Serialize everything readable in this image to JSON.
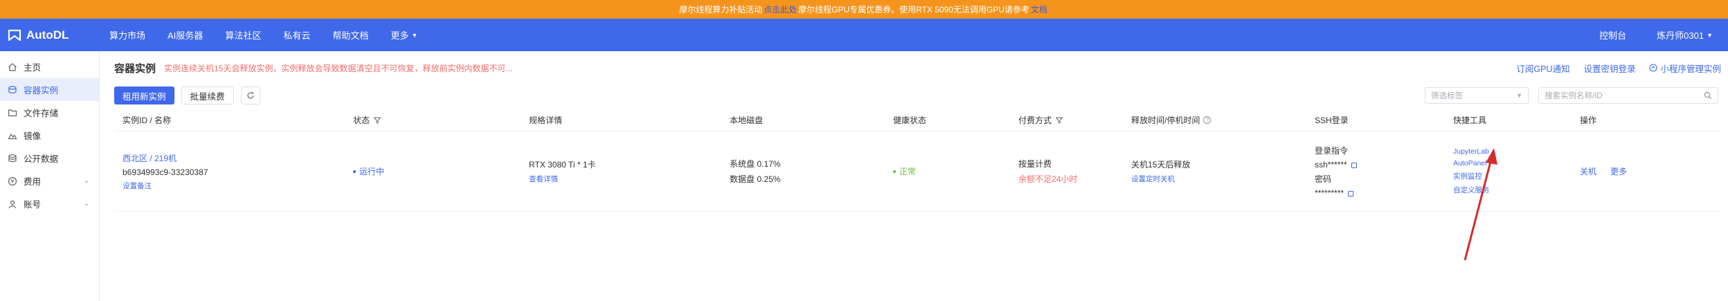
{
  "banner": {
    "text_pre": "摩尔线程算力补贴活动",
    "link1": "点击此处",
    "text_mid": "摩尔线程GPU专属优惠券。使用RTX 5090无法调用GPU请参考",
    "link2": "文档"
  },
  "nav": {
    "logo": "AutoDL",
    "items": [
      {
        "label": "算力市场"
      },
      {
        "label": "AI服务器"
      },
      {
        "label": "算法社区"
      },
      {
        "label": "私有云"
      },
      {
        "label": "帮助文档"
      },
      {
        "label": "更多"
      }
    ],
    "console": "控制台",
    "user": "炼丹师0301"
  },
  "sidebar": {
    "items": [
      {
        "label": "主页",
        "icon": "home-icon"
      },
      {
        "label": "容器实例",
        "icon": "container-icon"
      },
      {
        "label": "文件存储",
        "icon": "folder-icon"
      },
      {
        "label": "镜像",
        "icon": "image-icon"
      },
      {
        "label": "公开数据",
        "icon": "database-icon"
      },
      {
        "label": "费用",
        "icon": "yen-icon"
      },
      {
        "label": "账号",
        "icon": "user-icon"
      }
    ]
  },
  "main": {
    "title": "容器实例",
    "notice": "实例连续关机15天会释放实例，实例释放会导致数据清空且不可恢复，释放前实例内数据不可...",
    "links": {
      "gpu_notify": "订阅GPU通知",
      "key_login": "设置密钥登录",
      "mini_program": "小程序管理实例"
    },
    "toolbar": {
      "rent": "租用新实例",
      "batch_renew": "批量续费",
      "filter_placeholder": "筛选标签",
      "search_placeholder": "搜索实例名称/ID"
    },
    "table": {
      "headers": [
        "实例ID / 名称",
        "状态",
        "规格详情",
        "本地磁盘",
        "健康状态",
        "付费方式",
        "释放时间/停机时间",
        "SSH登录",
        "快捷工具",
        "操作"
      ],
      "row": {
        "region": "西北区 / 219机",
        "instance_id": "b6934993c9-33230387",
        "set_remark": "设置备注",
        "status": "运行中",
        "gpu": "RTX 3080 Ti * 1卡",
        "view_detail": "查看详情",
        "sys_disk": "系统盘 0.17%",
        "data_disk": "数据盘 0.25%",
        "health": "正常",
        "billing": "按量计费",
        "balance_warn": "余额不足24小时",
        "release": "关机15天后释放",
        "set_shutdown": "设置定时关机",
        "ssh_cmd_label": "登录指令",
        "ssh_cmd": "ssh******",
        "pwd_label": "密码",
        "pwd": "*********",
        "tool_jupyter": "JupyterLab",
        "tool_autopanel": "AutoPanel",
        "tool_proxy": "实例监控",
        "tool_custom": "自定义服务",
        "op_shutdown": "关机",
        "op_more": "更多"
      }
    }
  },
  "colors": {
    "banner": "#f5941d",
    "primary": "#3f68eb",
    "danger": "#f56c6c",
    "success": "#67c23a",
    "annotation_arrow": "#d62b2b"
  }
}
